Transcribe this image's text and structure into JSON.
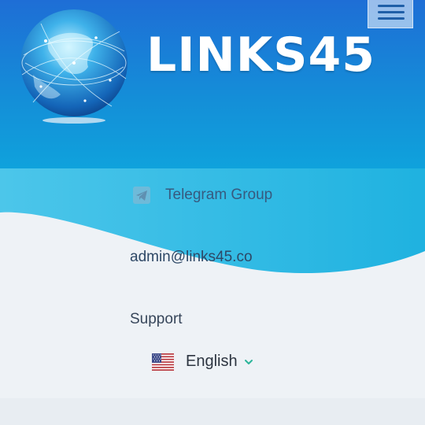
{
  "brand": {
    "name": "LINKS45"
  },
  "header": {
    "menu_icon": "hamburger-menu-icon"
  },
  "links": {
    "telegram_label": "Telegram Group",
    "telegram_icon": "telegram-icon",
    "email": "admin@links45.co",
    "support_label": "Support"
  },
  "language": {
    "selected": "English",
    "flag_icon": "us-flag-icon",
    "chevron_icon": "chevron-down-icon"
  },
  "colors": {
    "header_top": "#1e6ed6",
    "header_bottom": "#0fa2dc",
    "wave": "#22b7e3",
    "background": "#eef2f6",
    "chevron": "#2bb59a"
  }
}
